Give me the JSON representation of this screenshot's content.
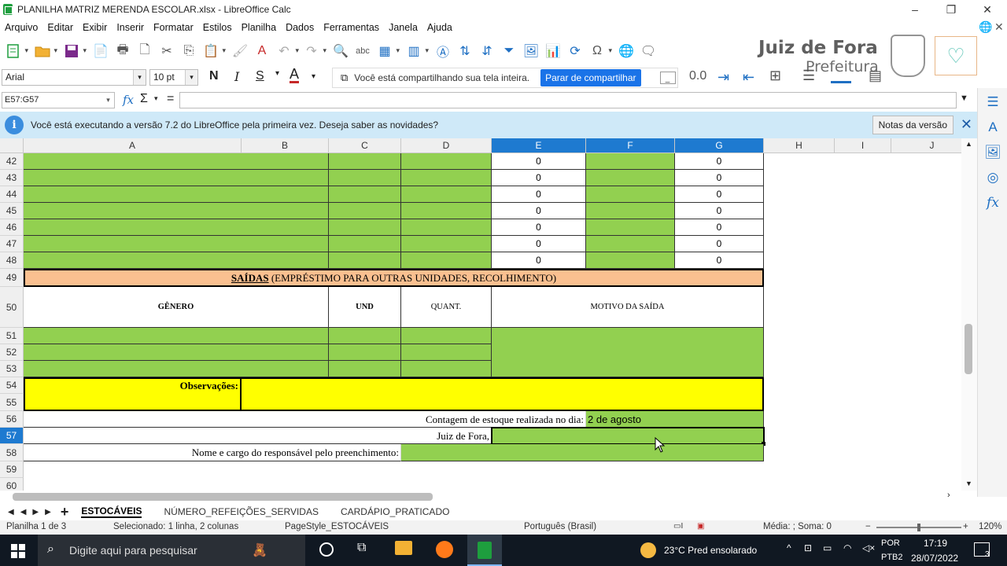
{
  "window": {
    "title": "PLANILHA MATRIZ MERENDA ESCOLAR.xlsx - LibreOffice Calc"
  },
  "menu": [
    "Arquivo",
    "Editar",
    "Exibir",
    "Inserir",
    "Formatar",
    "Estilos",
    "Planilha",
    "Dados",
    "Ferramentas",
    "Janela",
    "Ajuda"
  ],
  "watermark": {
    "title": "Juiz de Fora",
    "subtitle": "Prefeitura"
  },
  "format_bar": {
    "font": "Arial",
    "size": "10 pt",
    "bold": "N",
    "italic": "I",
    "underline": "S",
    "font_color": "A"
  },
  "share": {
    "text": "Você está compartilhando sua tela inteira.",
    "button": "Parar de compartilhar"
  },
  "formula_bar": {
    "name_box": "E57:G57",
    "fx": "fx",
    "sigma": "Σ",
    "equals": "="
  },
  "infobar": {
    "message": "Você está executando a versão 7.2 do LibreOffice pela primeira vez. Deseja saber as novidades?",
    "button": "Notas da versão"
  },
  "columns": [
    "A",
    "B",
    "C",
    "D",
    "E",
    "F",
    "G",
    "H",
    "I",
    "J"
  ],
  "rows": [
    "42",
    "43",
    "44",
    "45",
    "46",
    "47",
    "48",
    "49",
    "50",
    "51",
    "52",
    "53",
    "54",
    "55",
    "56",
    "57",
    "58",
    "59",
    "60"
  ],
  "cells": {
    "zero": "0",
    "saidas_bold": "SAÍDAS",
    "saidas_rest": " (EMPRÉSTIMO PARA OUTRAS UNIDADES, RECOLHIMENTO)",
    "genero": "GÊNERO",
    "und": "UND",
    "quant": "QUANT.",
    "motivo": "MOTIVO DA SAÍDA",
    "observacoes": "Observações:",
    "contagem": "Contagem de estoque realizada no dia:",
    "contagem_val": "2 de agosto",
    "juiz": "Juiz de Fora,",
    "nome": "Nome e cargo do responsável pelo preenchimento:"
  },
  "sheet_tabs": [
    "ESTOCÁVEIS",
    "NÚMERO_REFEIÇÕES_SERVIDAS",
    "CARDÁPIO_PRATICADO"
  ],
  "status": {
    "sheet": "Planilha 1 de 3",
    "selected": "Selecionado: 1 linha, 2 colunas",
    "style": "PageStyle_ESTOCÁVEIS",
    "lang": "Português (Brasil)",
    "sum": "Média: ; Soma: 0",
    "zoom": "120%"
  },
  "taskbar": {
    "search": "Digite aqui para pesquisar",
    "weather": "23°C  Pred ensolarado",
    "lang1": "POR",
    "lang2": "PTB2",
    "time": "17:19",
    "date": "28/07/2022",
    "notif": "3"
  },
  "colors": {
    "green": "#92d050",
    "salmon": "#fac090",
    "yellow": "#ffff00",
    "select": "#1e7ad0"
  }
}
